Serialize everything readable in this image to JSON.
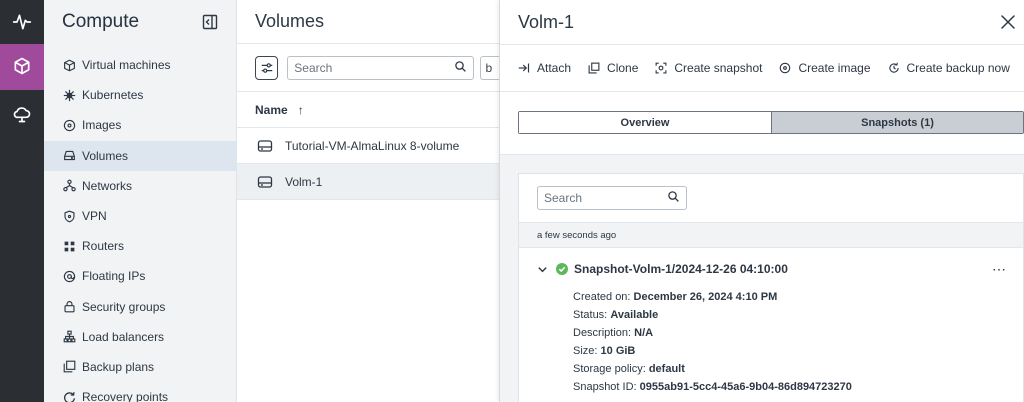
{
  "rail": {
    "items": [
      {
        "icon": "activity-icon"
      },
      {
        "icon": "cube-icon",
        "active": true
      },
      {
        "icon": "cloud-icon"
      }
    ]
  },
  "sidebar": {
    "title": "Compute",
    "items": [
      {
        "label": "Virtual machines",
        "icon": "cube-icon"
      },
      {
        "label": "Kubernetes",
        "icon": "kubernetes-icon"
      },
      {
        "label": "Images",
        "icon": "disc-icon"
      },
      {
        "label": "Volumes",
        "icon": "hard-drive-icon",
        "active": true
      },
      {
        "label": "Networks",
        "icon": "network-icon"
      },
      {
        "label": "VPN",
        "icon": "shield-icon"
      },
      {
        "label": "Routers",
        "icon": "router-icon"
      },
      {
        "label": "Floating IPs",
        "icon": "at-icon"
      },
      {
        "label": "Security groups",
        "icon": "lock-icon"
      },
      {
        "label": "Load balancers",
        "icon": "load-balancer-icon"
      },
      {
        "label": "Backup plans",
        "icon": "backup-icon"
      },
      {
        "label": "Recovery points",
        "icon": "recovery-icon"
      }
    ]
  },
  "list": {
    "title": "Volumes",
    "search_placeholder": "Search",
    "truncated_filter": "b",
    "column_name": "Name",
    "sort_indicator": "↑",
    "rows": [
      {
        "name": "Tutorial-VM-AlmaLinux 8-volume"
      },
      {
        "name": "Volm-1",
        "selected": true
      }
    ]
  },
  "panel": {
    "title": "Volm-1",
    "actions": [
      {
        "label": "Attach",
        "icon": "attach-icon"
      },
      {
        "label": "Clone",
        "icon": "clone-icon"
      },
      {
        "label": "Create snapshot",
        "icon": "snapshot-icon"
      },
      {
        "label": "Create image",
        "icon": "image-icon"
      },
      {
        "label": "Create backup now",
        "icon": "backup-icon"
      }
    ],
    "more_label": "⋯",
    "tabs": {
      "overview": "Overview",
      "snapshots": "Snapshots (1)"
    },
    "snapshots": {
      "search_placeholder": "Search",
      "group_label": "a few seconds ago",
      "item": {
        "name": "Snapshot-Volm-1/2024-12-26 04:10:00",
        "more_label": "⋯",
        "details": [
          {
            "label": "Created on:",
            "value": "December 26, 2024 4:10 PM"
          },
          {
            "label": "Status:",
            "value": "Available"
          },
          {
            "label": "Description:",
            "value": "N/A"
          },
          {
            "label": "Size:",
            "value": "10 GiB"
          },
          {
            "label": "Storage policy:",
            "value": "default"
          },
          {
            "label": "Snapshot ID:",
            "value": "0955ab91-5cc4-45a6-9b04-86d894723270"
          }
        ]
      }
    }
  },
  "colors": {
    "rail_bg": "#2b2f33",
    "rail_active": "#a04a9c",
    "sidebar_bg": "#f1f3f5",
    "sidebar_active": "#dde5ee",
    "success": "#5cb85c"
  }
}
